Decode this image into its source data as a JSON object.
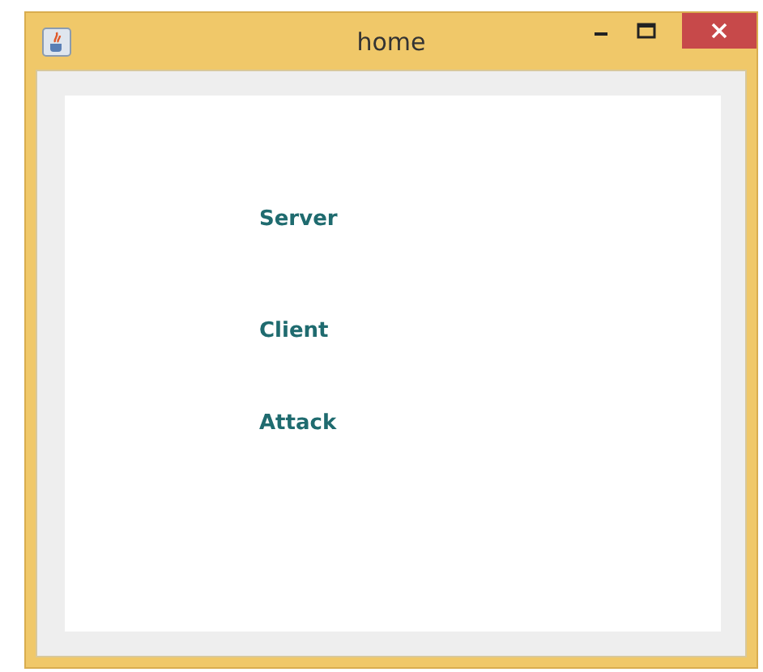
{
  "window": {
    "title": "home"
  },
  "labels": [
    "Server",
    "Client",
    "Attack"
  ]
}
